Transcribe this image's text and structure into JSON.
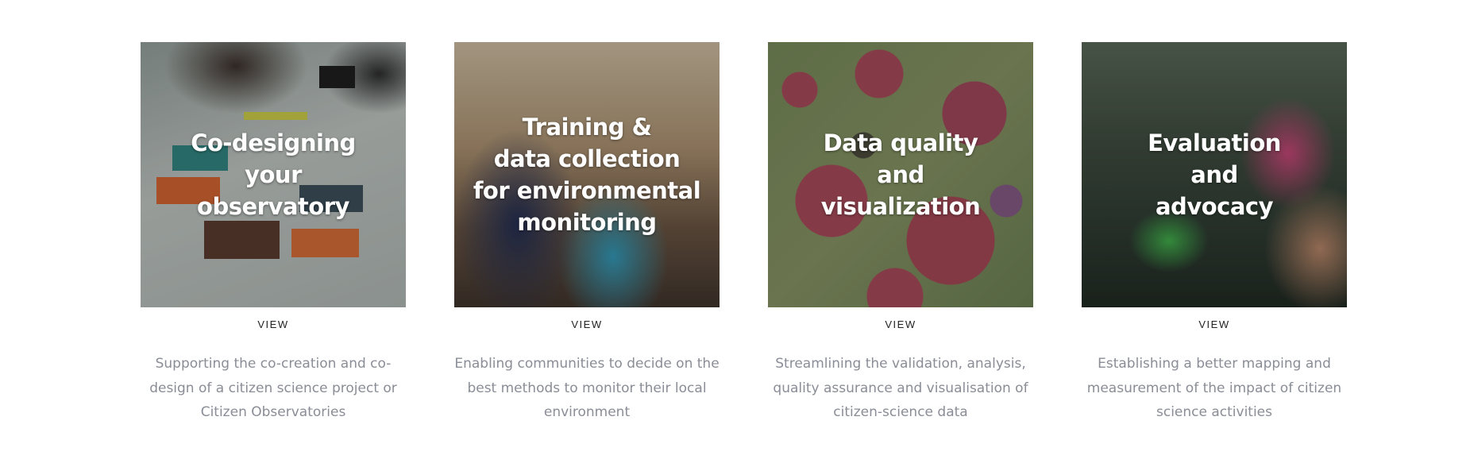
{
  "cards": [
    {
      "title": "Co-designing\nyour\nobservatory",
      "view_label": "VIEW",
      "description": "Supporting the co-creation and co-\ndesign of a citizen science project or\nCitizen Observatories"
    },
    {
      "title": "Training &\ndata collection\nfor environmental\nmonitoring",
      "view_label": "VIEW",
      "description": "Enabling communities to decide on the\nbest methods to monitor their local\nenvironment"
    },
    {
      "title": "Data quality\nand\nvisualization",
      "view_label": "VIEW",
      "description": "Streamlining the validation, analysis,\nquality assurance and visualisation of\ncitizen-science data"
    },
    {
      "title": "Evaluation\nand\nadvocacy",
      "view_label": "VIEW",
      "description": "Establishing a better mapping and\nmeasurement of the impact of citizen\nscience activities"
    }
  ],
  "colors": {
    "description_text": "#8a8d96",
    "view_text": "#222222",
    "title_text": "#ffffff"
  }
}
